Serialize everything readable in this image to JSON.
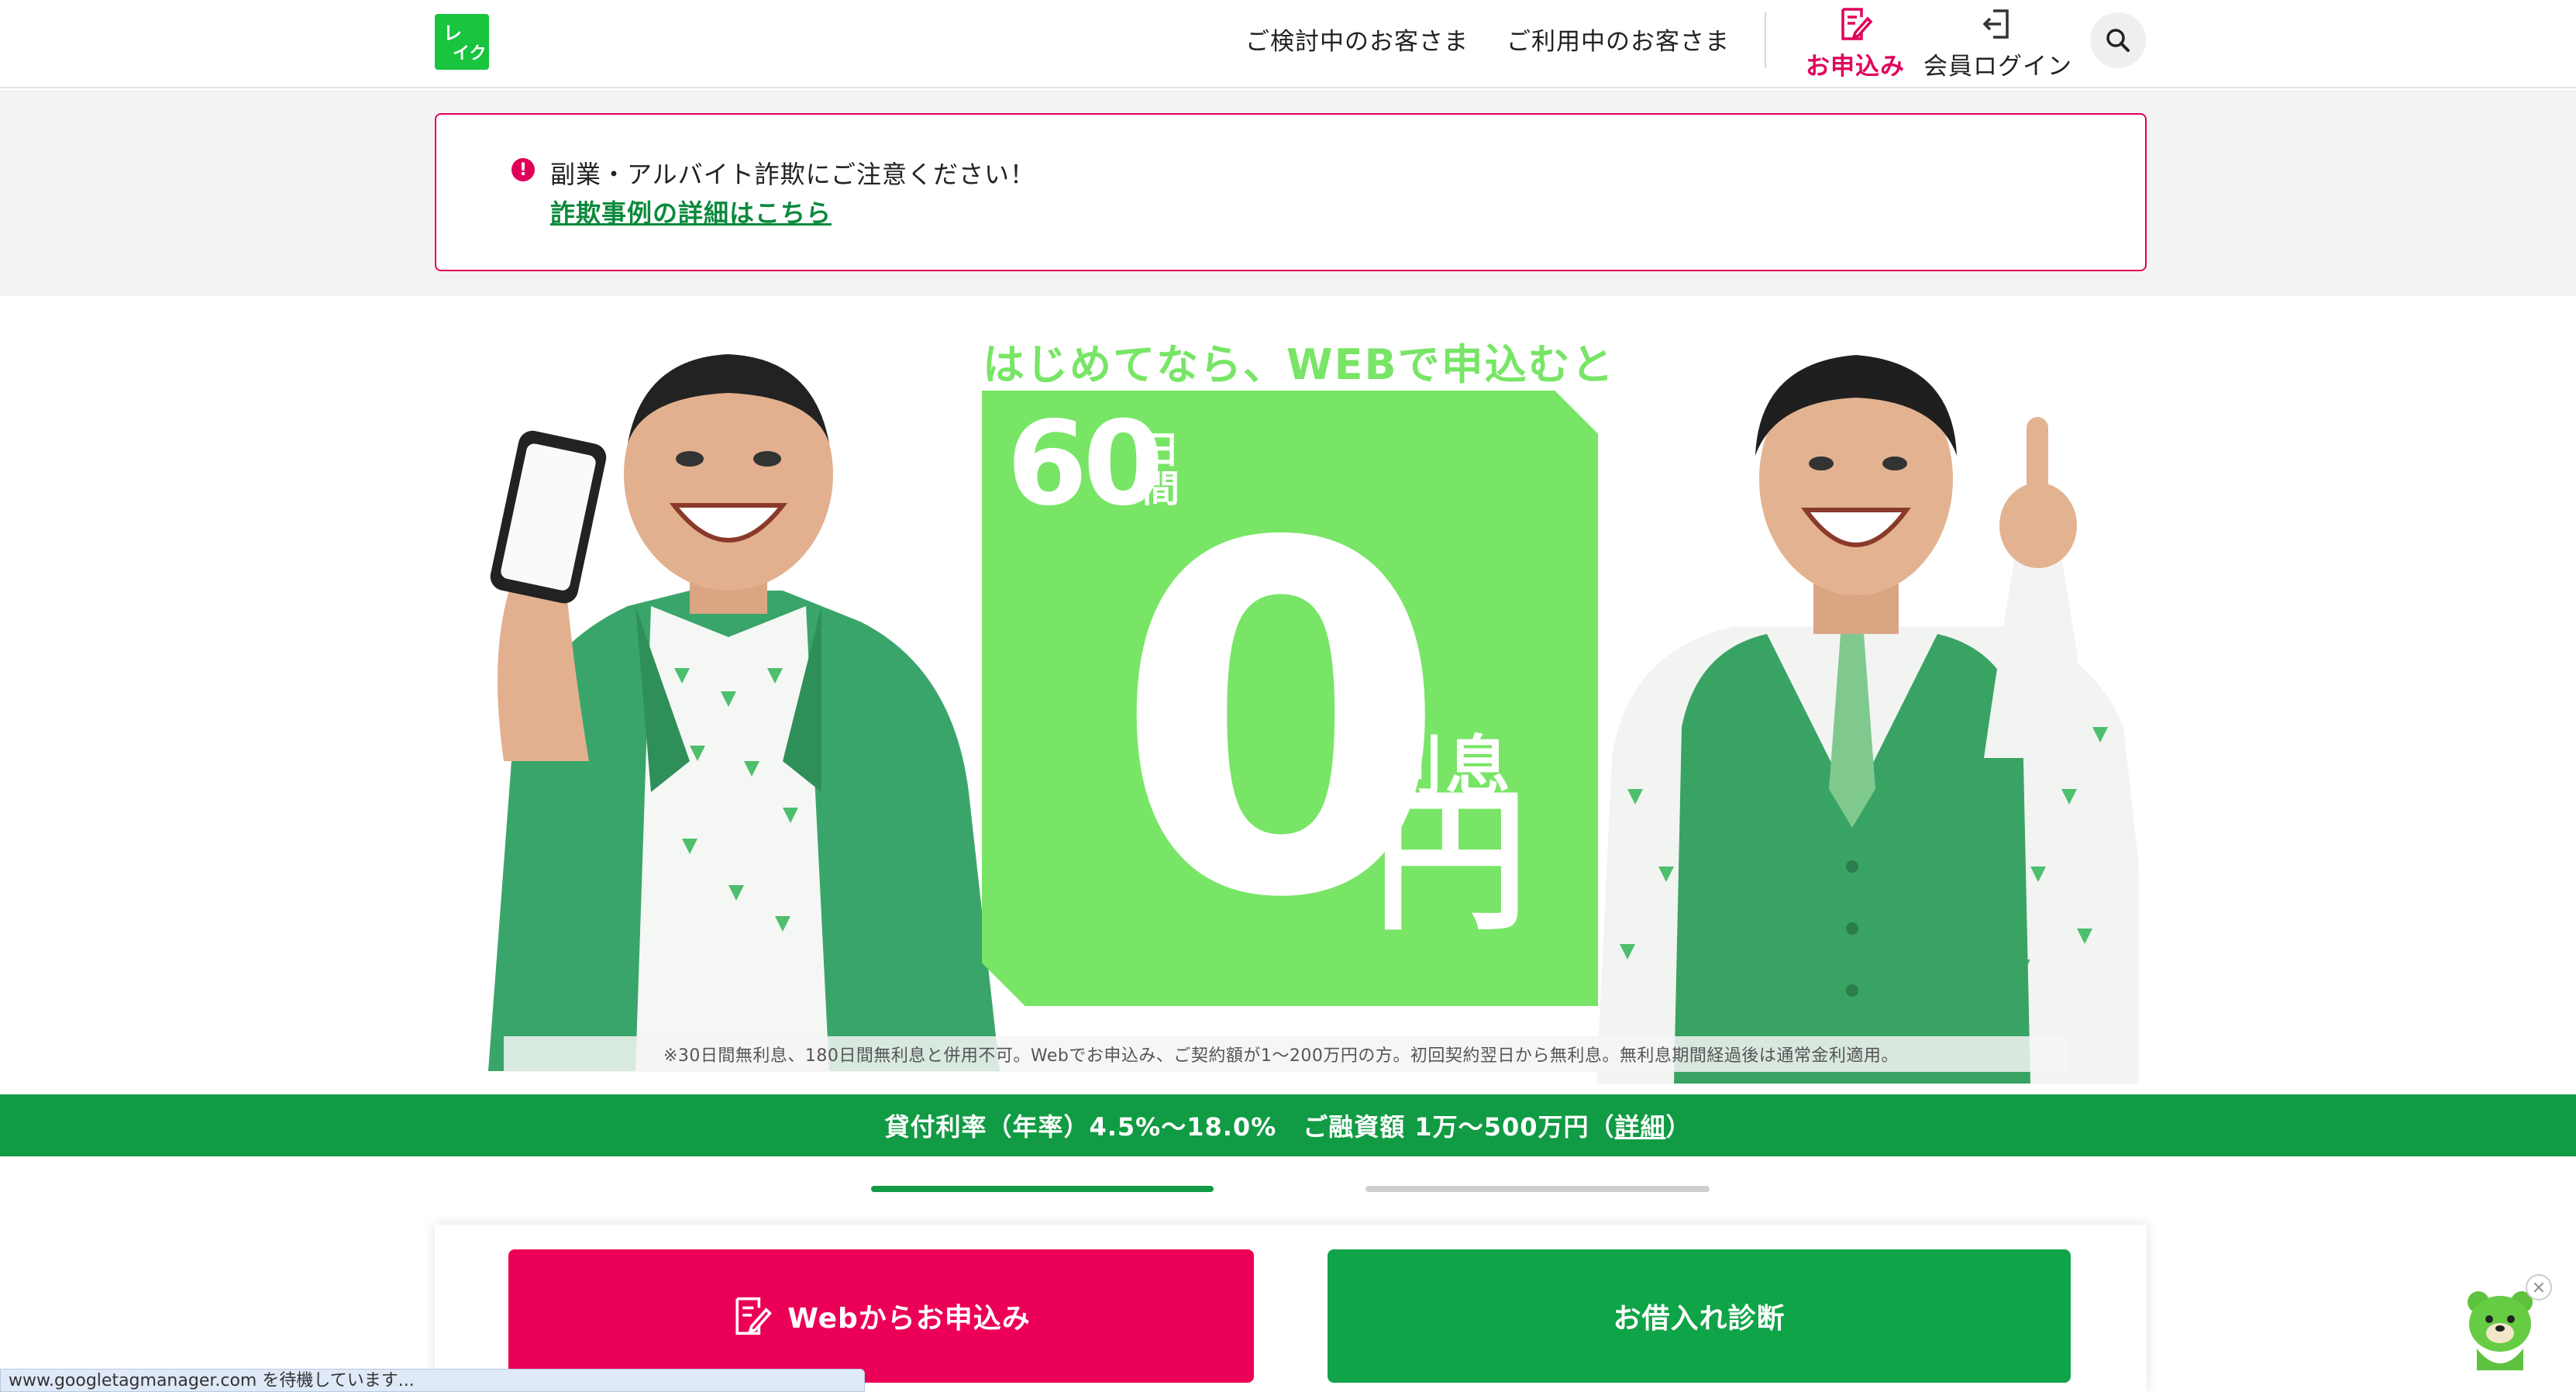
{
  "header": {
    "logo_text": "レイク",
    "nav_links": [
      "ご検討中のお客さま",
      "ご利用中のお客さま"
    ],
    "apply_label": "お申込み",
    "login_label": "会員ログイン",
    "accent_color": "#e0005b"
  },
  "notice": {
    "mark": "!",
    "text": "副業・アルバイト詐欺にご注意ください！",
    "link": "詐欺事例の詳細はこちら"
  },
  "hero": {
    "headline": "はじめてなら、WEBで申込むと",
    "promo_number": "60",
    "promo_days": "日間",
    "promo_zero": "0",
    "promo_interest": "利息",
    "promo_yen": "円",
    "disclaimer": "※30日間無利息、180日間無利息と併用不可。Webでお申込み、ご契約額が1～200万円の方。初回契約翌日から無利息。無利息期間経過後は通常金利適用。"
  },
  "rate_bar": {
    "rate": "貸付利率（年率）4.5%～18.0%",
    "limit": "ご融資額 1万～500万円（",
    "detail_link": "詳細",
    "close_paren": "）"
  },
  "slider": {
    "total": 2,
    "active": 1
  },
  "cta": {
    "apply": "Webからお申込み",
    "diagnose": "お借入れ診断"
  },
  "status_bar": "www.googletagmanager.com を待機しています..."
}
